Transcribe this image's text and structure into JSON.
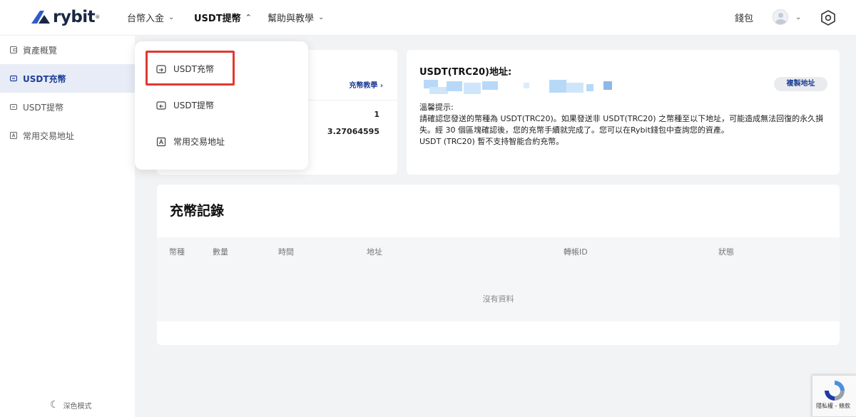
{
  "brand": {
    "name": "rybit",
    "reg_mark": "®",
    "color": "#1a2744"
  },
  "nav": {
    "items": [
      {
        "label": "台幣入金",
        "active": false
      },
      {
        "label": "USDT提幣",
        "active": true
      },
      {
        "label": "幫助與教學",
        "active": false
      }
    ],
    "wallet_label": "錢包"
  },
  "sidebar": {
    "items": [
      {
        "label": "資產概覽",
        "icon": "wallet-icon"
      },
      {
        "label": "USDT充幣",
        "icon": "deposit-icon",
        "active": true
      },
      {
        "label": "USDT提幣",
        "icon": "withdraw-icon"
      },
      {
        "label": "常用交易地址",
        "icon": "address-book-icon"
      }
    ],
    "dark_mode_label": "深色模式"
  },
  "dropdown": {
    "items": [
      {
        "label": "USDT充幣",
        "highlighted": true
      },
      {
        "label": "USDT提幣"
      },
      {
        "label": "常用交易地址"
      }
    ]
  },
  "left_card": {
    "tutorial_label": "充幣教學 ›",
    "value_1": "1",
    "value_2": "3.27064595"
  },
  "address_card": {
    "title": "USDT(TRC20)地址:",
    "copy_label": "複製地址",
    "notice_title": "溫馨提示:",
    "notice_lines": [
      "請確認您發送的幣種為 USDT(TRC20)。如果發送非 USDT(TRC20) 之幣種至以下地址，可能造成無法回復的永久損失。經 30 個區塊確認後，您的充幣手續就完成了。您可以在Rybit錢包中查詢您的資產。",
      "USDT (TRC20) 暫不支持智能合約充幣。"
    ]
  },
  "records": {
    "title": "充幣記錄",
    "columns": [
      "幣種",
      "數量",
      "時間",
      "地址",
      "轉帳ID",
      "狀態"
    ],
    "empty_text": "沒有資料"
  },
  "recaptcha": {
    "text": "隱私權 - 條款"
  },
  "colors": {
    "accent": "#1f3f96",
    "highlight": "#e03a32",
    "active_bg": "#e8ecf7"
  }
}
